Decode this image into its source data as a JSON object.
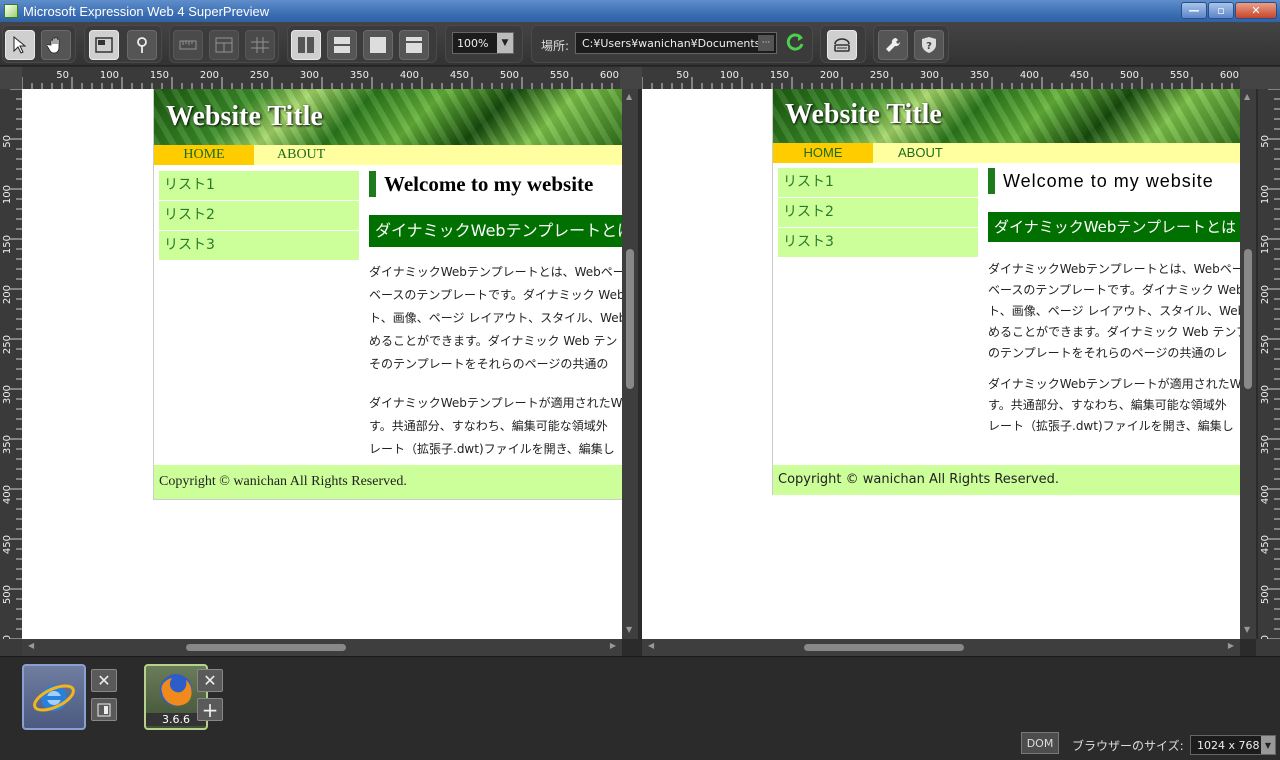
{
  "window": {
    "title": "Microsoft Expression Web 4 SuperPreview",
    "minimize": "—",
    "maximize": "▫",
    "close": "✕"
  },
  "toolbar": {
    "zoom_value": "100%",
    "location_label": "場所:",
    "location_value": "C:¥Users¥wanichan¥Documents",
    "location_more": "···"
  },
  "rulers": {
    "h_ticks": [
      "50",
      "100",
      "150",
      "200",
      "250",
      "300",
      "350",
      "400",
      "450",
      "500",
      "550",
      "600"
    ],
    "v_ticks": [
      "50",
      "100",
      "150",
      "200",
      "250",
      "300",
      "350",
      "400",
      "450",
      "500",
      "550"
    ]
  },
  "website": {
    "title": "Website Title",
    "nav": [
      "HOME",
      "ABOUT"
    ],
    "side": [
      "リスト1",
      "リスト2",
      "リスト3"
    ],
    "heading": "Welcome to my website",
    "subheading": "ダイナミックWebテンプレートとは",
    "footer": "Copyright © wanichan All Rights Reserved."
  },
  "left_pane": {
    "body_lines": [
      "ダイナミックWebテンプレートとは、Webページ",
      "ベースのテンプレートです。ダイナミック Web",
      "ト、画像、ページ レイアウト、スタイル、Web",
      "めることができます。ダイナミック Web テン",
      "そのテンプレートをそれらのページの共通の"
    ],
    "body_lines2": [
      "ダイナミックWebテンプレートが適用されたW",
      "す。共通部分、すなわち、編集可能な領域外",
      "レート（拡張子.dwt)ファイルを開き、編集し"
    ]
  },
  "right_pane": {
    "body_lines": [
      "ダイナミックWebテンプレートとは、Webページ",
      "ベースのテンプレートです。ダイナミック Web",
      "ト、画像、ページ レイアウト、スタイル、Web",
      "めることができます。ダイナミック Web テンプ",
      "のテンプレートをそれらのページの共通のレ"
    ],
    "body_lines2": [
      "ダイナミックWebテンプレートが適用されたW",
      "す。共通部分、すなわち、編集可能な領域外",
      "レート（拡張子.dwt)ファイルを開き、編集し"
    ]
  },
  "dock": {
    "firefox_version": "3.6.6",
    "close_symbol": "✕",
    "add_symbol": "+"
  },
  "status": {
    "dom_label": "DOM",
    "size_label": "ブラウザーのサイズ:",
    "size_value": "1024 x 768"
  },
  "colors": {
    "accent_green": "#007000",
    "nav_home": "#ffcc00",
    "side_bg": "#ccff99",
    "nav_bg": "#ffffa0"
  }
}
